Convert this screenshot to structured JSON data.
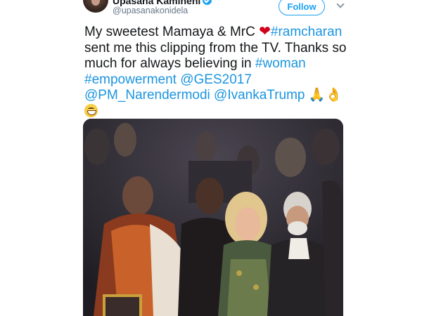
{
  "user": {
    "name": "Upasana Kamineni",
    "handle": "@upasanakonidela",
    "verified_icon": "verified-badge-icon"
  },
  "follow_button": {
    "label": "Follow"
  },
  "more_menu": {
    "icon": "chevron-down-icon"
  },
  "tweet": {
    "line1_a": "My sweetest Mamaya & MrC",
    "heart": "❤",
    "hashtag_ramcharan": "#ramcharan",
    "line2": "sent me this clipping from the TV. Thanks so",
    "line3_a": "much for always believing in",
    "hashtag_woman": "#woman",
    "hashtag_empowerment": "#empowerment",
    "hashtag_ges": "@GES2017",
    "mention_pm": "@PM_Narendermodi",
    "mention_ivanka": "@IvankaTrump",
    "emoji_folded_hands": "🙏",
    "emoji_ok_hand": "👌",
    "emoji_grin_icon": "grinning-face-icon"
  },
  "media": {
    "type": "photo",
    "description_icon": "tv-clipping-photo"
  },
  "colors": {
    "link": "#1b95e0",
    "follow": "#1da1f2",
    "text": "#14171a",
    "muted": "#657786"
  }
}
